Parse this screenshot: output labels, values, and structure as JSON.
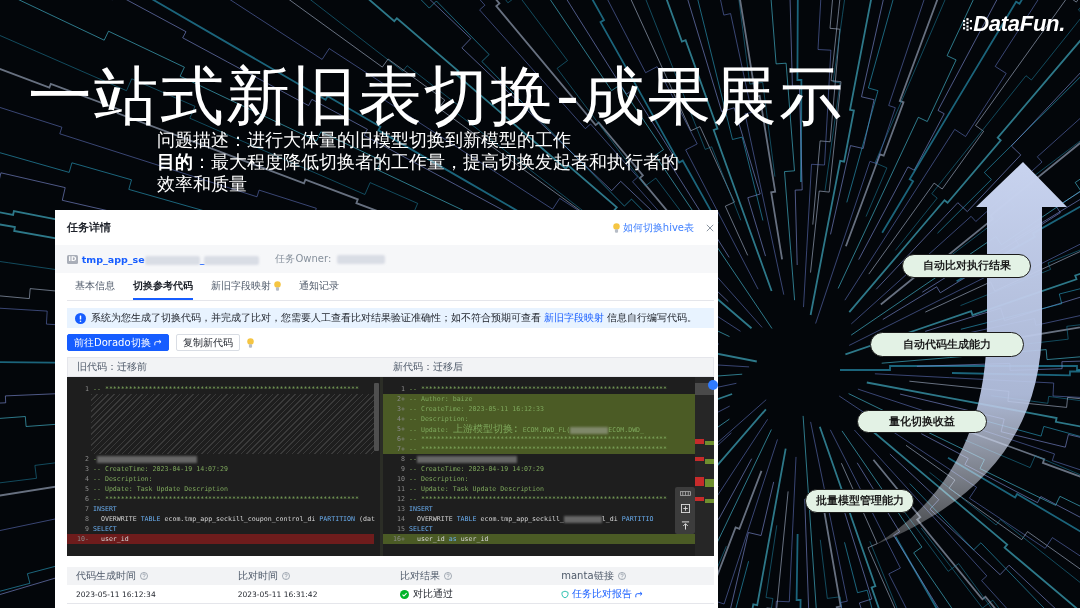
{
  "logo": {
    "text": "DataFun."
  },
  "title": "一站式新旧表切换-成果展示",
  "description": [
    "问题描述：进行大体量的旧模型切换到新模型的工作",
    "**目的**：最大程度降低切换者的工作量，提高切换发起者和执行者的效率和质量"
  ],
  "task_panel": {
    "title": "任务详情",
    "help_link": "如何切换hive表",
    "task_id": {
      "badge": "ID",
      "segments": [
        {
          "kind": "text",
          "text": "tmp_app_se"
        },
        {
          "kind": "blurred"
        },
        {
          "kind": "text",
          "text": "_"
        },
        {
          "kind": "blurred"
        }
      ]
    },
    "owner": {
      "label": "任务Owner:",
      "value_blurred": true
    },
    "tabs": [
      {
        "label": "基本信息",
        "selected": false,
        "hint": false
      },
      {
        "label": "切换参考代码",
        "selected": true,
        "hint": false
      },
      {
        "label": "新旧字段映射",
        "selected": false,
        "hint": true
      },
      {
        "label": "通知记录",
        "selected": false,
        "hint": false
      }
    ],
    "notice": {
      "before": "系统为您生成了切换代码，并完成了比对，您需要人工查看比对结果验证准确性；如不符合预期可查看",
      "link": "新旧字段映射",
      "after": "信息自行编写代码。"
    },
    "buttons": [
      {
        "label": "前往Dorado切换",
        "kind": "primary"
      },
      {
        "label": "复制新代码",
        "kind": "default"
      }
    ],
    "diff": {
      "panes": [
        {
          "header": "旧代码：迁移前",
          "lines": [
            {
              "kind": "line",
              "number": "1",
              "segments": [
                {
                  "kind": "comment",
                  "text": "-- ****************************************************************"
                }
              ]
            },
            {
              "kind": "gap"
            },
            {
              "kind": "gap"
            },
            {
              "kind": "gap"
            },
            {
              "kind": "gap"
            },
            {
              "kind": "gap"
            },
            {
              "kind": "gap"
            },
            {
              "kind": "line",
              "number": "2",
              "segments": [
                {
                  "kind": "comment",
                  "text": "-"
                },
                {
                  "kind": "blurred"
                }
              ]
            },
            {
              "kind": "line",
              "number": "3",
              "segments": [
                {
                  "kind": "comment",
                  "text": "-- CreateTime: 2023-04-19 14:07:29"
                }
              ]
            },
            {
              "kind": "line",
              "number": "4",
              "segments": [
                {
                  "kind": "comment",
                  "text": "-- Description:"
                }
              ]
            },
            {
              "kind": "line",
              "number": "5",
              "segments": [
                {
                  "kind": "comment",
                  "text": "-- Update: Task Update Description"
                }
              ]
            },
            {
              "kind": "line",
              "number": "6",
              "segments": [
                {
                  "kind": "comment",
                  "text": "-- ****************************************************************"
                }
              ]
            },
            {
              "kind": "line",
              "number": "7",
              "segments": [
                {
                  "kind": "keyword",
                  "text": "INSERT"
                }
              ]
            },
            {
              "kind": "line",
              "number": "8",
              "segments": [
                {
                  "kind": "plain",
                  "text": "  OVERWRITE "
                },
                {
                  "kind": "keyword",
                  "text": "TABLE"
                },
                {
                  "kind": "plain",
                  "text": " ecom.tmp_app_seckill_coupon_control_di "
                },
                {
                  "kind": "keyword",
                  "text": "PARTITION"
                },
                {
                  "kind": "plain",
                  "text": " (dat"
                }
              ]
            },
            {
              "kind": "line",
              "number": "9",
              "segments": [
                {
                  "kind": "keyword",
                  "text": "SELECT"
                }
              ]
            },
            {
              "kind": "removed",
              "number": "10-",
              "segments": [
                {
                  "kind": "plain",
                  "text": "  user_id"
                }
              ]
            }
          ]
        },
        {
          "header": "新代码：迁移后",
          "lines": [
            {
              "kind": "line",
              "number": "1",
              "segments": [
                {
                  "kind": "comment",
                  "text": "-- **************************************************************"
                }
              ]
            },
            {
              "kind": "added",
              "number": "2+",
              "segments": [
                {
                  "kind": "comment",
                  "text": "-- Author: baize"
                }
              ]
            },
            {
              "kind": "added",
              "number": "3+",
              "segments": [
                {
                  "kind": "comment",
                  "text": "-- CreateTime: 2023-05-11 16:12:33"
                }
              ]
            },
            {
              "kind": "added",
              "number": "4+",
              "segments": [
                {
                  "kind": "comment",
                  "text": "-- Description:"
                }
              ]
            },
            {
              "kind": "added",
              "number": "5+",
              "segments": [
                {
                  "kind": "comment",
                  "text": "-- Update: "
                },
                {
                  "kind": "comment_cjk",
                  "text": "上游模型切换:"
                },
                {
                  "kind": "comment",
                  "text": " ECOM.DWD_FL("
                },
                {
                  "kind": "blurred"
                },
                {
                  "kind": "comment",
                  "text": "ECOM.DWD_"
                }
              ]
            },
            {
              "kind": "added",
              "number": "6+",
              "segments": [
                {
                  "kind": "comment",
                  "text": "-- **************************************************************"
                }
              ]
            },
            {
              "kind": "added",
              "number": "7+",
              "segments": [
                {
                  "kind": "comment",
                  "text": "-- **************************************************************"
                }
              ]
            },
            {
              "kind": "line",
              "number": "8",
              "segments": [
                {
                  "kind": "comment",
                  "text": "--"
                },
                {
                  "kind": "blurred"
                }
              ]
            },
            {
              "kind": "line",
              "number": "9",
              "segments": [
                {
                  "kind": "comment",
                  "text": "-- CreateTime: 2023-04-19 14:07:29"
                }
              ]
            },
            {
              "kind": "line",
              "number": "10",
              "segments": [
                {
                  "kind": "comment",
                  "text": "-- Description:"
                }
              ]
            },
            {
              "kind": "line",
              "number": "11",
              "segments": [
                {
                  "kind": "comment",
                  "text": "-- Update: Task Update Description"
                }
              ]
            },
            {
              "kind": "line",
              "number": "12",
              "segments": [
                {
                  "kind": "comment",
                  "text": "-- **************************************************************"
                }
              ]
            },
            {
              "kind": "line",
              "number": "13",
              "segments": [
                {
                  "kind": "keyword",
                  "text": "INSERT"
                }
              ]
            },
            {
              "kind": "line",
              "number": "14",
              "segments": [
                {
                  "kind": "plain",
                  "text": "  OVERWRITE "
                },
                {
                  "kind": "keyword",
                  "text": "TABLE"
                },
                {
                  "kind": "plain",
                  "text": " ecom.tmp_app_seckill_"
                },
                {
                  "kind": "blurred"
                },
                {
                  "kind": "plain",
                  "text": "l_di "
                },
                {
                  "kind": "keyword",
                  "text": "PARTITIO"
                }
              ]
            },
            {
              "kind": "line",
              "number": "15",
              "segments": [
                {
                  "kind": "keyword",
                  "text": "SELECT"
                }
              ]
            },
            {
              "kind": "added",
              "number": "16+",
              "segments": [
                {
                  "kind": "plain",
                  "text": "  user_id "
                },
                {
                  "kind": "keyword",
                  "text": "as"
                },
                {
                  "kind": "plain",
                  "text": " user_id"
                }
              ]
            }
          ]
        }
      ]
    },
    "results_table": {
      "columns": [
        "代码生成时间",
        "比对时间",
        "比对结果",
        "manta链接"
      ],
      "rows": [
        {
          "generated_at": "2023-05-11 16:12:34",
          "compared_at": "2023-05-11 16:31:42",
          "result": {
            "passed": true,
            "text": "对比通过"
          },
          "link": "任务比对报告"
        }
      ]
    }
  },
  "capabilities": [
    "自动比对执行结果",
    "自动代码生成能力",
    "量化切换收益",
    "批量模型管理能力"
  ]
}
